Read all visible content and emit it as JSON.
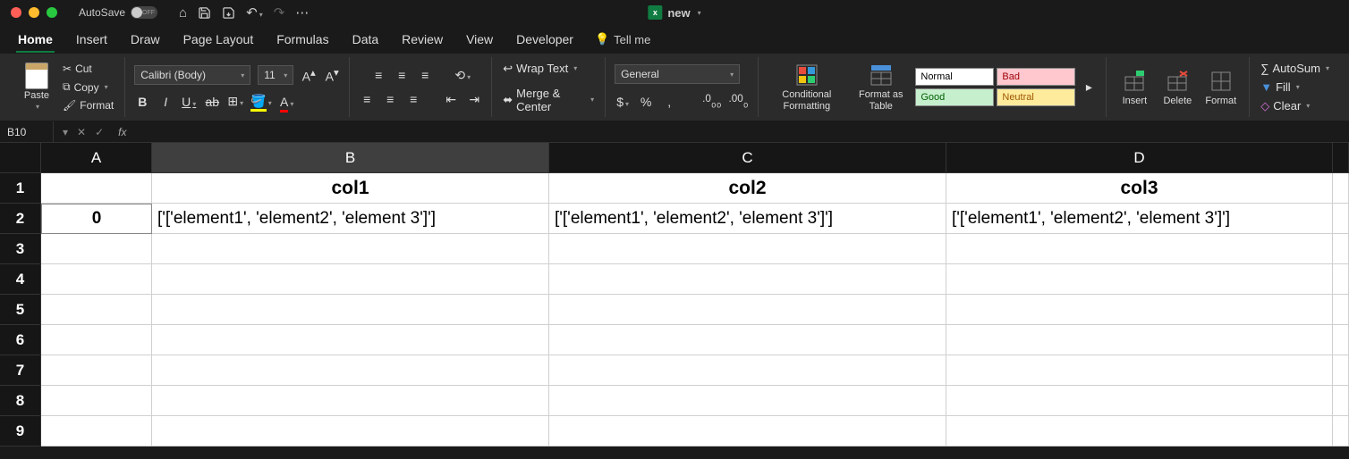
{
  "titlebar": {
    "autosave_label": "AutoSave",
    "autosave_state": "OFF",
    "doc_name": "new"
  },
  "tabs": [
    "Home",
    "Insert",
    "Draw",
    "Page Layout",
    "Formulas",
    "Data",
    "Review",
    "View",
    "Developer"
  ],
  "tellme": "Tell me",
  "ribbon": {
    "paste": "Paste",
    "cut": "Cut",
    "copy": "Copy",
    "format_painter": "Format",
    "font_name": "Calibri (Body)",
    "font_size": "11",
    "wrap_text": "Wrap Text",
    "merge_center": "Merge & Center",
    "number_format": "General",
    "cond_fmt": "Conditional Formatting",
    "fmt_table": "Format as Table",
    "styles": {
      "normal": "Normal",
      "bad": "Bad",
      "good": "Good",
      "neutral": "Neutral"
    },
    "insert": "Insert",
    "delete": "Delete",
    "format": "Format",
    "autosum": "AutoSum",
    "fill": "Fill",
    "clear": "Clear"
  },
  "namebox": "B10",
  "columns": [
    "A",
    "B",
    "C",
    "D"
  ],
  "rows": [
    "1",
    "2",
    "3",
    "4",
    "5",
    "6",
    "7",
    "8",
    "9"
  ],
  "grid": {
    "r1": {
      "A": "",
      "B": "col1",
      "C": "col2",
      "D": "col3"
    },
    "r2": {
      "A": "0",
      "B": "['['element1', 'element2', 'element 3']']",
      "C": "['['element1', 'element2', 'element 3']']",
      "D": "['['element1', 'element2', 'element 3']']"
    }
  }
}
